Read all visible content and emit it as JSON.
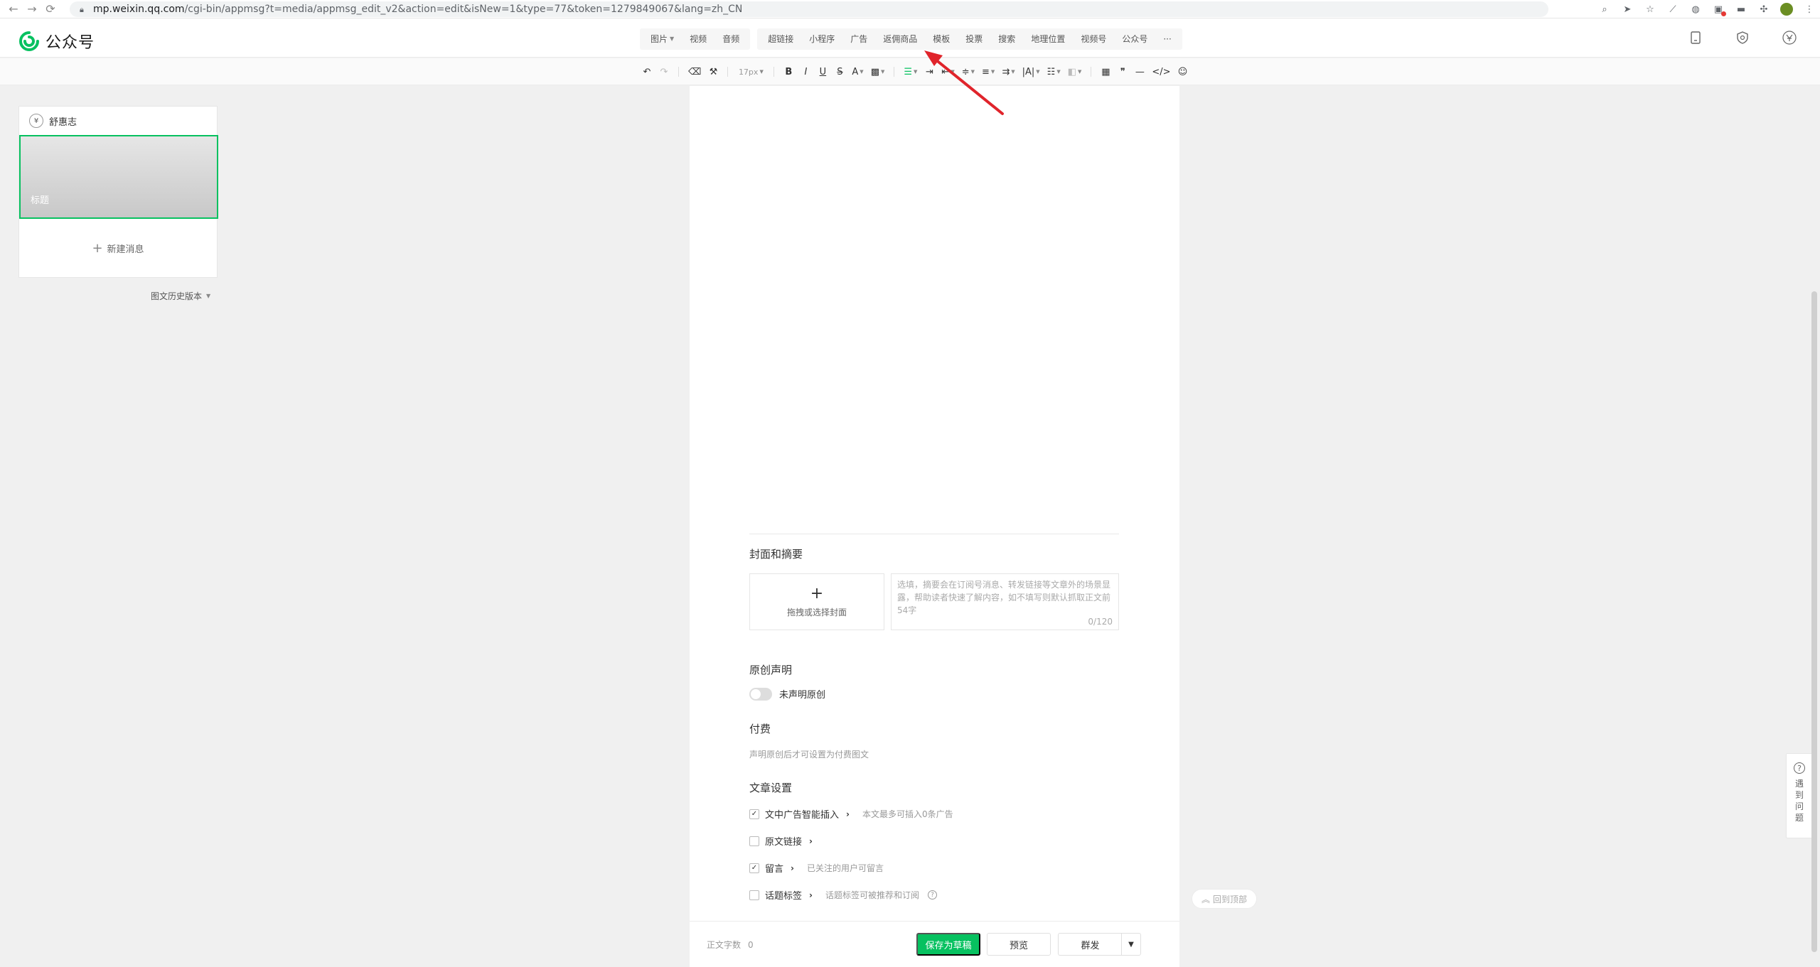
{
  "browser": {
    "url_domain": "mp.weixin.qq.com",
    "url_path": "/cgi-bin/appmsg?t=media/appmsg_edit_v2&action=edit&isNew=1&type=77&token=1279849067&lang=zh_CN"
  },
  "header": {
    "logo_text": "公众号",
    "insert_groups": [
      [
        {
          "label": "图片",
          "caret": true
        },
        {
          "label": "视频"
        },
        {
          "label": "音频"
        }
      ],
      [
        {
          "label": "超链接"
        },
        {
          "label": "小程序"
        },
        {
          "label": "广告"
        },
        {
          "label": "返佣商品"
        },
        {
          "label": "模板"
        },
        {
          "label": "投票"
        },
        {
          "label": "搜索"
        },
        {
          "label": "地理位置"
        },
        {
          "label": "视频号"
        },
        {
          "label": "公众号"
        },
        {
          "label": "···"
        }
      ]
    ]
  },
  "toolbar": {
    "font_size": "17px"
  },
  "left_panel": {
    "account_name": "舒惠志",
    "article_title": "标题",
    "new_message": "新建消息",
    "history_label": "图文历史版本"
  },
  "settings": {
    "cover_section_title": "封面和摘要",
    "cover_hint": "拖拽或选择封面",
    "summary_placeholder": "选填，摘要会在订阅号消息、转发链接等文章外的场景显露，帮助读者快速了解内容，如不填写则默认抓取正文前54字",
    "summary_count": "0/120",
    "original_title": "原创声明",
    "original_toggle_label": "未声明原创",
    "paid_title": "付费",
    "paid_desc": "声明原创后才可设置为付费图文",
    "article_settings_title": "文章设置",
    "rows": [
      {
        "label": "文中广告智能插入",
        "desc": "本文最多可插入0条广告",
        "checked": true
      },
      {
        "label": "原文链接",
        "desc": "",
        "checked": false
      },
      {
        "label": "留言",
        "desc": "已关注的用户可留言",
        "checked": true
      },
      {
        "label": "话题标签",
        "desc": "话题标签可被推荐和订阅",
        "checked": false
      }
    ]
  },
  "footer": {
    "word_count_label": "正文字数",
    "word_count": "0",
    "save_label": "保存为草稿",
    "preview_label": "预览",
    "publish_label": "群发"
  },
  "floating": {
    "back_top": "回到顶部",
    "help": "遇到问题"
  },
  "colors": {
    "accent": "#07c160",
    "annotation": "#e0242b"
  }
}
